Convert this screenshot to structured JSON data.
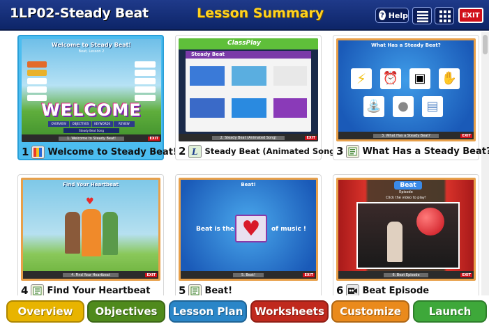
{
  "header": {
    "course_title": "1LP02-Steady Beat",
    "page_title": "Lesson Summary",
    "help_label": "Help",
    "help_symbol": "?",
    "exit_label": "EXIT",
    "list_view_icon": "list-view-icon",
    "grid_view_icon": "grid-view-icon"
  },
  "cards": [
    {
      "number": "1",
      "title": "Welcome to Steady Beat!",
      "icon": "flag-icon",
      "thumb": {
        "heading": "Welcome to Steady Beat!",
        "subheading": "Beat, Lesson 2",
        "big_text": "WELCOME",
        "tabs": [
          "OVERVIEW",
          "OBJECTIVES",
          "KEYWORDS",
          "REVIEW"
        ],
        "footer": "Steady Beat Song",
        "bar": "1. Welcome to Steady Beat!",
        "exit": "EXIT"
      }
    },
    {
      "number": "2",
      "title": "Steady Beat (Animated Song)",
      "icon": "song-icon",
      "thumb": {
        "brand": "ClassPlay",
        "heading": "Steady Beat",
        "bar": "2. Steady Beat (Animated Song)",
        "exit": "EXIT"
      }
    },
    {
      "number": "3",
      "title": "What Has a Steady Beat?",
      "icon": "activity-icon",
      "thumb": {
        "heading": "What Has a Steady Beat?",
        "bar": "3. What Has a Steady Beat?",
        "exit": "EXIT"
      }
    },
    {
      "number": "4",
      "title": "Find Your Heartbeat",
      "icon": "activity-icon",
      "thumb": {
        "heading": "Find Your Heartbeat",
        "bar": "4. Find Your Heartbeat",
        "exit": "EXIT"
      }
    },
    {
      "number": "5",
      "title": "Beat!",
      "icon": "activity-icon",
      "thumb": {
        "heading": "Beat!",
        "text_left": "Beat is the",
        "text_right": "of music !",
        "bar": "5. Beat!",
        "exit": "EXIT"
      }
    },
    {
      "number": "6",
      "title": "Beat Episode",
      "icon": "film-icon",
      "thumb": {
        "heading": "Beat",
        "subheading": "Episode",
        "instruction": "Click the video to play!",
        "bar": "6. Beat Episode",
        "exit": "EXIT"
      }
    }
  ],
  "bottom_nav": [
    {
      "label": "Overview",
      "color": "#e8b400"
    },
    {
      "label": "Objectives",
      "color": "#4f8a1c"
    },
    {
      "label": "Lesson Plan",
      "color": "#2a86c8"
    },
    {
      "label": "Worksheets",
      "color": "#c0291d"
    },
    {
      "label": "Customize",
      "color": "#ea8a1c"
    },
    {
      "label": "Launch",
      "color": "#3ea83a"
    }
  ],
  "colors": {
    "header_bg": "#1f3a8a",
    "accent_yellow": "#ffd21f",
    "selected_card": "#4cbdf0",
    "exit_red": "#d0101a"
  }
}
